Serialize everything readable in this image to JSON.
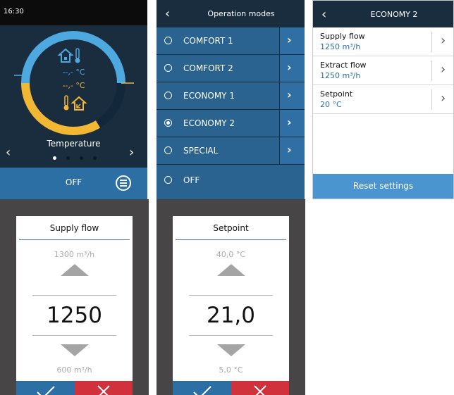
{
  "home": {
    "time": "16:30",
    "indoor_temp": "--,- °C",
    "outdoor_temp": "--,- °C",
    "screen_label": "Temperature",
    "page_count": 4,
    "active_page": 1,
    "mode_button": "OFF",
    "icons": [
      "house-indoor-icon",
      "thermometer-icon",
      "house-outdoor-icon",
      "menu-icon",
      "chevron-left-icon",
      "chevron-right-icon"
    ]
  },
  "operation_modes": {
    "title": "Operation modes",
    "items": [
      {
        "label": "COMFORT 1",
        "selected": false,
        "has_arrow": true
      },
      {
        "label": "COMFORT 2",
        "selected": false,
        "has_arrow": true
      },
      {
        "label": "ECONOMY 1",
        "selected": false,
        "has_arrow": true
      },
      {
        "label": "ECONOMY 2",
        "selected": true,
        "has_arrow": true
      },
      {
        "label": "SPECIAL",
        "selected": false,
        "has_arrow": true
      },
      {
        "label": "OFF",
        "selected": false,
        "has_arrow": false
      }
    ]
  },
  "economy2": {
    "title": "ECONOMY 2",
    "items": [
      {
        "label": "Supply flow",
        "value": "1250 m³/h"
      },
      {
        "label": "Extract flow",
        "value": "1250 m³/h"
      },
      {
        "label": "Setpoint",
        "value": "20 °C"
      }
    ],
    "reset_label": "Reset settings"
  },
  "supply_picker": {
    "title": "Supply flow",
    "max": "1300 m³/h",
    "current": "1250",
    "min": "600 m³/h"
  },
  "setpoint_picker": {
    "title": "Setpoint",
    "max": "40,0 °C",
    "current": "21,0",
    "min": "5,0 °C"
  },
  "colors": {
    "dark_navy": "#1a2d3e",
    "blue": "#2c6fa4",
    "accent_blue": "#4ea9e0",
    "accent_yellow": "#f2b733",
    "cancel_red": "#d0313a"
  }
}
